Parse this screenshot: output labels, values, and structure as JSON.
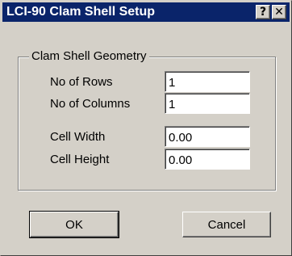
{
  "window": {
    "title": "LCI-90 Clam Shell Setup",
    "help_button": "?",
    "close_button": "✕"
  },
  "group": {
    "title": "Clam Shell Geometry"
  },
  "fields": {
    "rows": {
      "label": "No of Rows",
      "value": "1"
    },
    "columns": {
      "label": "No of Columns",
      "value": "1"
    },
    "cell_width": {
      "label": "Cell Width",
      "value": "0.00"
    },
    "cell_height": {
      "label": "Cell Height",
      "value": "0.00"
    }
  },
  "buttons": {
    "ok": "OK",
    "cancel": "Cancel"
  },
  "colors": {
    "titlebar": "#0a246a",
    "face": "#d4d0c8"
  }
}
